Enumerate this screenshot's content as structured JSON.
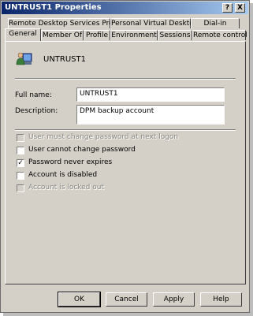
{
  "window": {
    "title": "UNTRUST1 Properties",
    "help_glyph": "?",
    "close_glyph": "X"
  },
  "tabs_back": [
    "Remote Desktop Services Profile",
    "Personal Virtual Desktop",
    "Dial-in"
  ],
  "tabs_front": [
    "General",
    "Member Of",
    "Profile",
    "Environment",
    "Sessions",
    "Remote control"
  ],
  "active_tab": "General",
  "general": {
    "username": "UNTRUST1",
    "full_name_label": "Full name:",
    "full_name_value": "UNTRUST1",
    "description_label": "Description:",
    "description_value": "DPM backup account",
    "checkboxes": [
      {
        "label": "User must change password at next logon",
        "checked": false,
        "enabled": false
      },
      {
        "label": "User cannot change password",
        "checked": false,
        "enabled": true
      },
      {
        "label": "Password never expires",
        "checked": true,
        "enabled": true
      },
      {
        "label": "Account is disabled",
        "checked": false,
        "enabled": true
      },
      {
        "label": "Account is locked out",
        "checked": false,
        "enabled": false
      }
    ]
  },
  "buttons": {
    "ok": "OK",
    "cancel": "Cancel",
    "apply": "Apply",
    "help": "Help"
  },
  "colors": {
    "title_start": "#0a246a",
    "title_end": "#a6caf0",
    "face": "#d4d0c8"
  },
  "icons": {
    "user": "user-icon",
    "help": "help-icon",
    "close": "close-icon"
  }
}
